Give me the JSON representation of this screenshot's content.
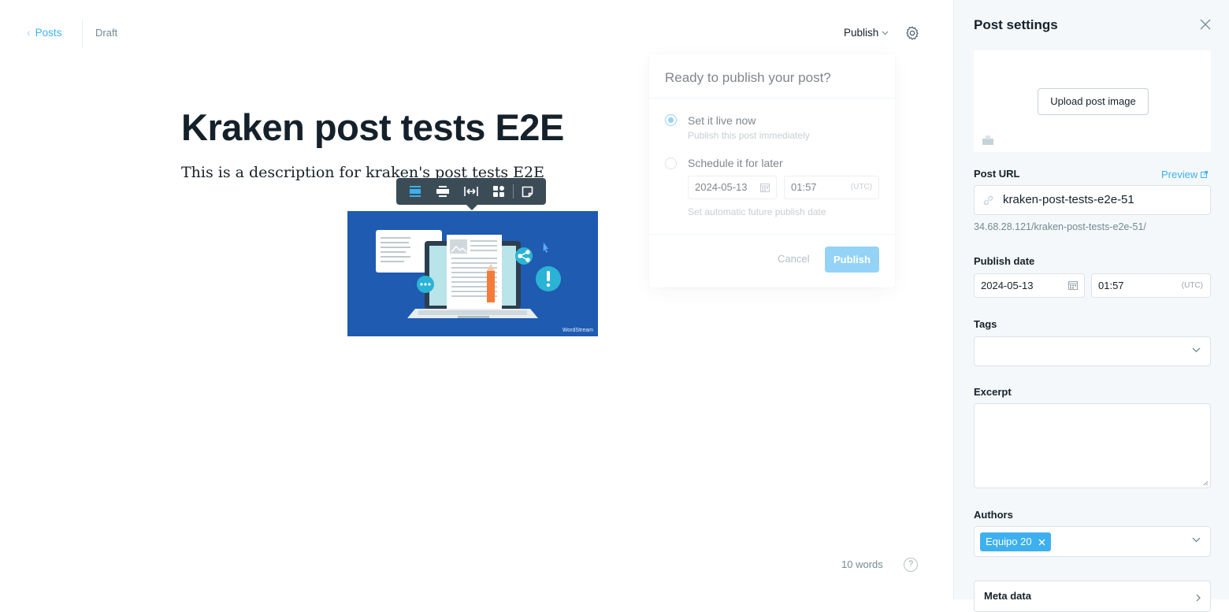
{
  "header": {
    "back_label": "Posts",
    "status": "Draft",
    "publish_label": "Publish"
  },
  "post": {
    "title": "Kraken post tests E2E",
    "excerpt_text": "This is a description for kraken's post tests E2E",
    "image_watermark": "WordStream"
  },
  "footer": {
    "word_count": "10 words",
    "help": "?"
  },
  "publish_panel": {
    "heading": "Ready to publish your post?",
    "option_now_title": "Set it live now",
    "option_now_sub": "Publish this post immediately",
    "option_later_title": "Schedule it for later",
    "date": "2024-05-13",
    "time": "01:57",
    "tz": "(UTC)",
    "option_later_sub": "Set automatic future publish date",
    "cancel_label": "Cancel",
    "publish_label": "Publish",
    "selected": "now"
  },
  "sidebar": {
    "title": "Post settings",
    "upload_label": "Upload post image",
    "url_label": "Post URL",
    "preview_label": "Preview",
    "url_value": "kraken-post-tests-e2e-51",
    "url_full": "34.68.28.121/kraken-post-tests-e2e-51/",
    "publish_date_label": "Publish date",
    "date": "2024-05-13",
    "time": "01:57",
    "tz": "(UTC)",
    "tags_label": "Tags",
    "excerpt_label": "Excerpt",
    "authors_label": "Authors",
    "authors": [
      "Equipo 20"
    ],
    "meta_label": "Meta data"
  },
  "colors": {
    "accent": "#3eb0ef",
    "text": "#15212a",
    "muted": "#738a94",
    "image_bg": "#1f5bb0"
  }
}
